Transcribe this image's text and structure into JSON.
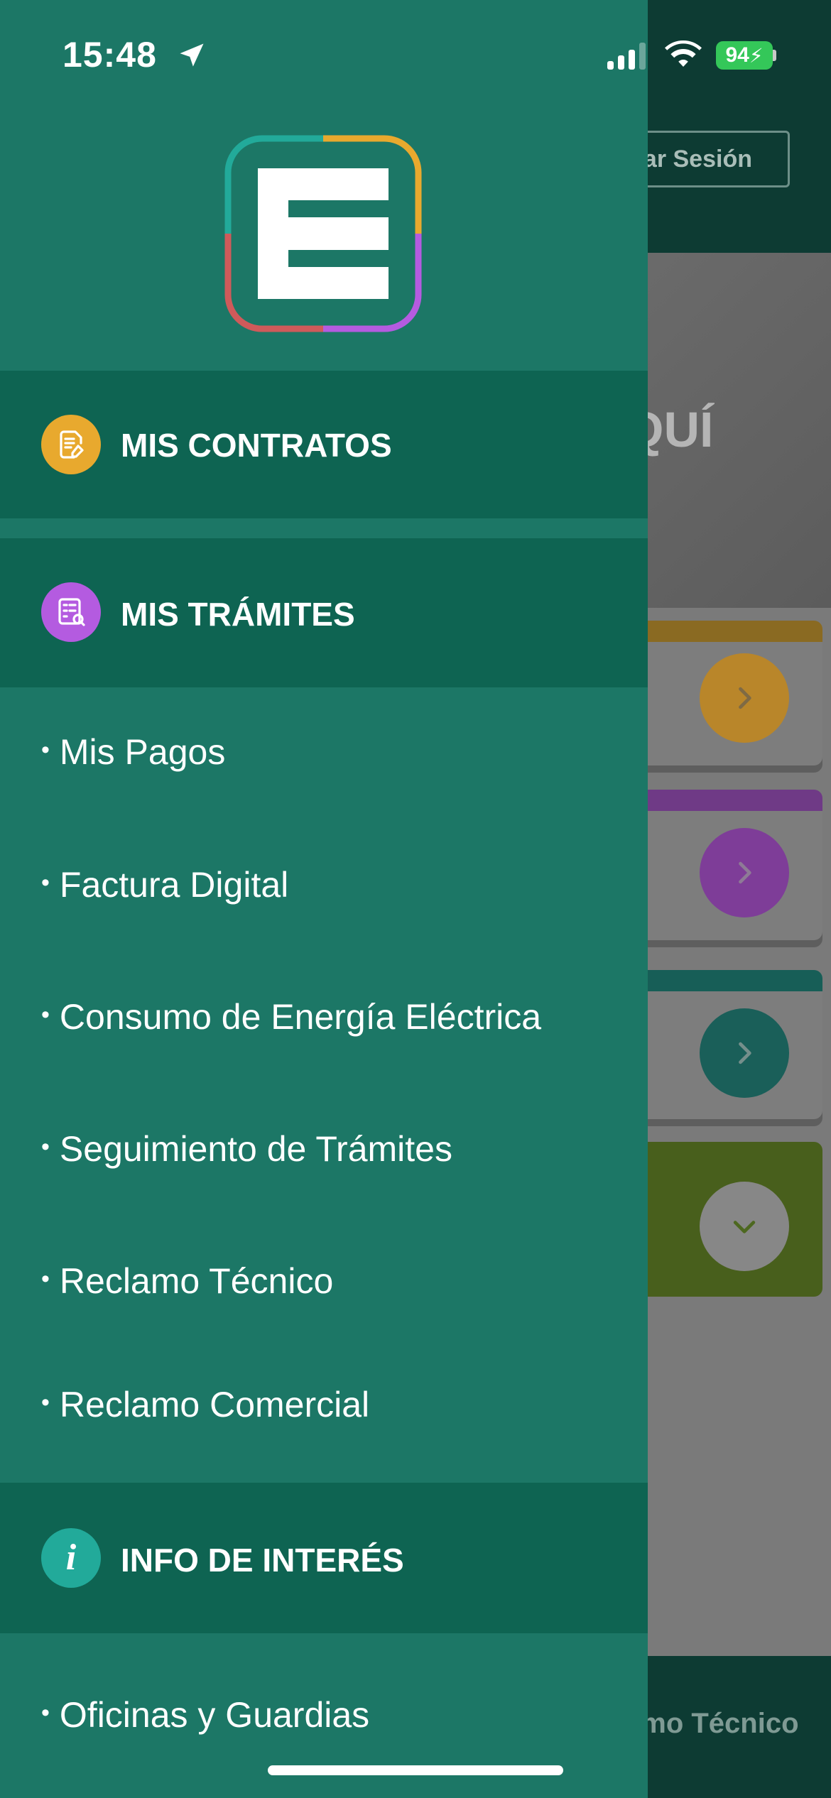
{
  "status": {
    "time": "15:48",
    "battery": "94"
  },
  "background": {
    "login_label": "ar Sesión",
    "hero_text": "QUÍ",
    "footer_label": "amo Técnico"
  },
  "drawer": {
    "sections": [
      {
        "label": "MIS CONTRATOS",
        "icon": "contract-edit-icon",
        "color": "#e8a92e"
      },
      {
        "label": "MIS TRÁMITES",
        "icon": "document-search-icon",
        "color": "#b45be0"
      },
      {
        "label": "INFO DE INTERÉS",
        "icon": "info-icon",
        "color": "#22aa9a"
      }
    ],
    "items": [
      "Mis Pagos",
      "Factura Digital",
      "Consumo de Energía Eléctrica",
      "Seguimiento de Trámites",
      "Reclamo Técnico",
      "Reclamo Comercial",
      "Oficinas y Guardias"
    ]
  },
  "colors": {
    "drawer_bg": "#1c7766",
    "section_bg": "#0e6452",
    "card_yellow": "#d79a2b",
    "card_purple": "#8a3fa6",
    "card_teal": "#137066",
    "card_green": "#6b8a1f"
  }
}
